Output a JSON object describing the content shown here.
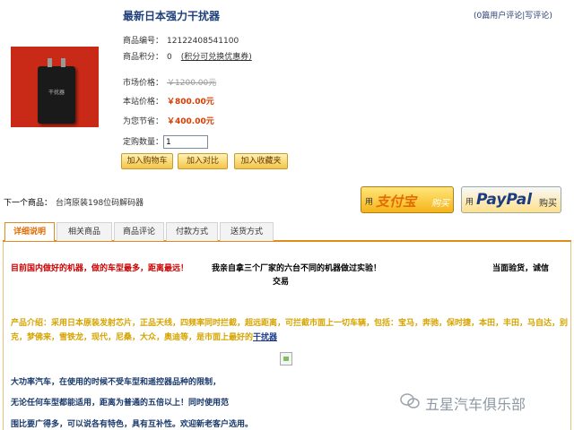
{
  "product": {
    "title": "最新日本强力干扰器",
    "code_label": "商品编号：",
    "code_value": "12122408541100",
    "points_label": "商品积分：",
    "points_value": "0",
    "points_link": "(积分可兑换优惠券)",
    "market_label": "市场价格：",
    "market_value": "￥1200.00元",
    "site_label": "本站价格：",
    "site_value": "￥800.00元",
    "save_label": "为您节省：",
    "save_value": "￥400.00元",
    "qty_label": "定购数量：",
    "qty_value": "1",
    "device_label": "干扰器"
  },
  "review_links": {
    "open": "(",
    "view": "0篇用户评论",
    "sep": "|",
    "write": "写评论",
    "close": ")"
  },
  "actions": {
    "add_cart": "加入购物车",
    "add_compare": "加入对比",
    "add_fav": "加入收藏夹"
  },
  "next": {
    "label": "下一个商品：",
    "link": "台湾原装198位码解码器"
  },
  "payment": {
    "alipay_pre": "用",
    "alipay_brand": "支付宝",
    "alipay_suf": "购买",
    "paypal_pre": "用",
    "paypal_brand": "PayPal",
    "paypal_suf": "购买"
  },
  "tabs": [
    {
      "label": "详细说明",
      "active": true
    },
    {
      "label": "相关商品",
      "active": false
    },
    {
      "label": "商品评论",
      "active": false
    },
    {
      "label": "付款方式",
      "active": false
    },
    {
      "label": "送货方式",
      "active": false
    }
  ],
  "content": {
    "headline": "目前国内做好的机器，做的车型最多，距离最远！",
    "headline2": "我亲自拿三个厂家的六台不同的机器做过实验！",
    "trade": "交易",
    "aside": "当面验货，诚信",
    "intro": "产品介绍：采用日本原装发射芯片，正品天线，四频率同时拦截，超远距离，可拦截市面上一切车辆，包括：宝马，奔驰，保时捷，本田，丰田，马自达，别克，梦佛来，雪铁龙，现代，尼桑，大众，奥迪等，是市面上最好的",
    "intro_link": "干扰器",
    "p1": "大功率汽车，在使用的时候不受车型和遥控器品种的限制，",
    "p2": "无论任何车型都能适用，距离为普通的五倍以上！同时使用范",
    "p3": "围比要广得多，可以说各有特色，具有互补性。欢迎新老客户选用。"
  },
  "watermark": {
    "text": "五星汽车俱乐部",
    "icon": "wechat-icon"
  }
}
